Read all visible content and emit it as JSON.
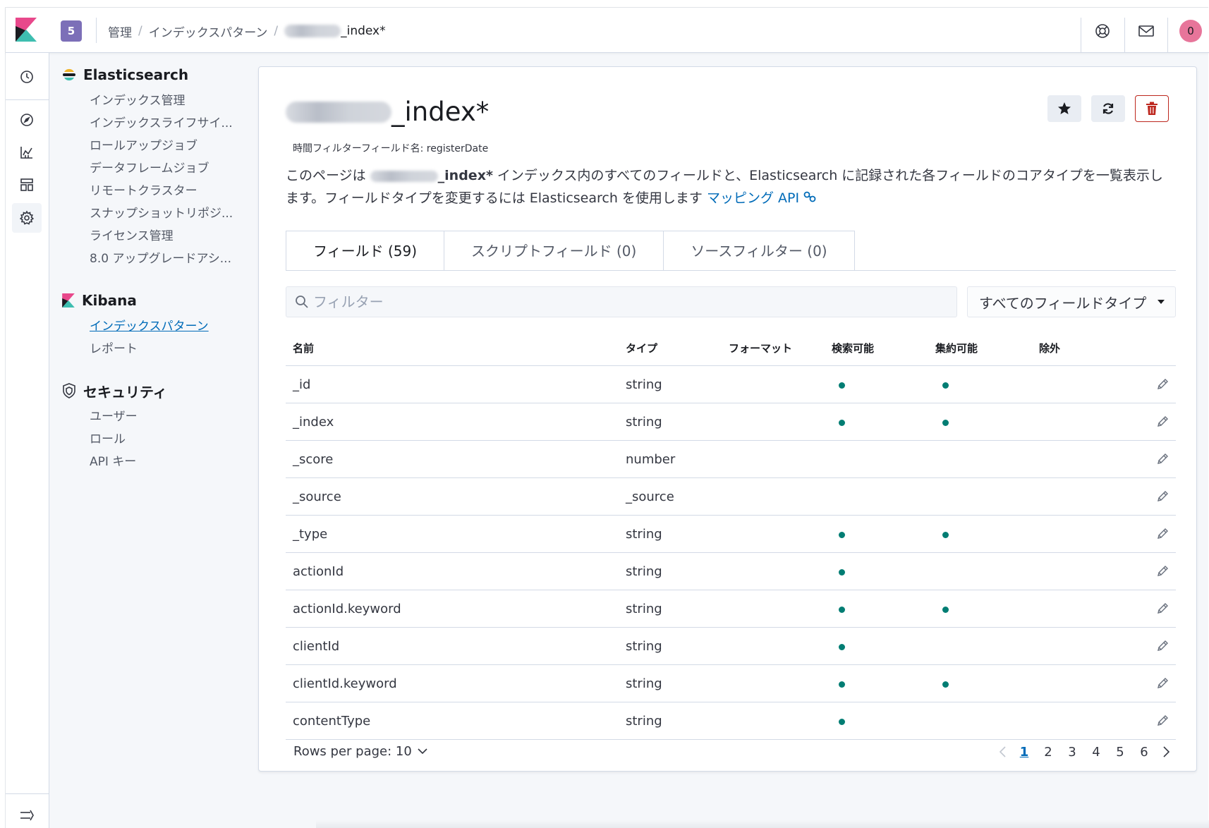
{
  "header": {
    "space_badge": "5",
    "breadcrumbs": [
      "管理",
      "インデックスパターン"
    ],
    "current_crumb_suffix": "_index*",
    "avatar_initial": "0"
  },
  "sidebar": {
    "elasticsearch": {
      "title": "Elasticsearch",
      "items": [
        "インデックス管理",
        "インデックスライフサイ...",
        "ロールアップジョブ",
        "データフレームジョブ",
        "リモートクラスター",
        "スナップショットリポジ...",
        "ライセンス管理",
        "8.0 アップグレードアシ..."
      ]
    },
    "kibana": {
      "title": "Kibana",
      "items": [
        "インデックスパターン",
        "レポート"
      ]
    },
    "security": {
      "title": "セキュリティ",
      "items": [
        "ユーザー",
        "ロール",
        "API キー"
      ]
    }
  },
  "main": {
    "title_suffix": "_index*",
    "time_field": "時間フィルターフィールド名: registerDate",
    "desc_before": "このページは ",
    "desc_index": "_index*",
    "desc_after": " インデックス内のすべてのフィールドと、Elasticsearch に記録された各フィールドのコアタイプを一覧表示します。フィールドタイプを変更するには Elasticsearch を使用します ",
    "desc_link": "マッピング API",
    "tabs": [
      "フィールド (59)",
      "スクリプトフィールド (0)",
      "ソースフィルター (0)"
    ],
    "filter_placeholder": "フィルター",
    "type_select": "すべてのフィールドタイプ",
    "columns": [
      "名前",
      "タイプ",
      "フォーマット",
      "検索可能",
      "集約可能",
      "除外"
    ],
    "rows": [
      {
        "name": "_id",
        "type": "string",
        "searchable": true,
        "aggregatable": true
      },
      {
        "name": "_index",
        "type": "string",
        "searchable": true,
        "aggregatable": true
      },
      {
        "name": "_score",
        "type": "number",
        "searchable": false,
        "aggregatable": false
      },
      {
        "name": "_source",
        "type": "_source",
        "searchable": false,
        "aggregatable": false
      },
      {
        "name": "_type",
        "type": "string",
        "searchable": true,
        "aggregatable": true
      },
      {
        "name": "actionId",
        "type": "string",
        "searchable": true,
        "aggregatable": false
      },
      {
        "name": "actionId.keyword",
        "type": "string",
        "searchable": true,
        "aggregatable": true
      },
      {
        "name": "clientId",
        "type": "string",
        "searchable": true,
        "aggregatable": false
      },
      {
        "name": "clientId.keyword",
        "type": "string",
        "searchable": true,
        "aggregatable": true
      },
      {
        "name": "contentType",
        "type": "string",
        "searchable": true,
        "aggregatable": false
      }
    ],
    "rows_per_page": "Rows per page: 10",
    "pages": [
      "1",
      "2",
      "3",
      "4",
      "5",
      "6"
    ],
    "active_page": "1"
  },
  "colors": {
    "accent_link": "#006bb8",
    "dot": "#017d73",
    "danger": "#bd271e",
    "space_badge": "#7c6fb8",
    "avatar": "#e7759a"
  },
  "icons": {
    "rail": [
      "clock-icon",
      "compass-icon",
      "visualize-icon",
      "dashboard-icon",
      "gear-icon",
      "collapse-menu-icon"
    ],
    "header": [
      "help-icon",
      "mail-icon"
    ],
    "actions": [
      "star-icon",
      "refresh-icon",
      "trash-icon"
    ]
  }
}
